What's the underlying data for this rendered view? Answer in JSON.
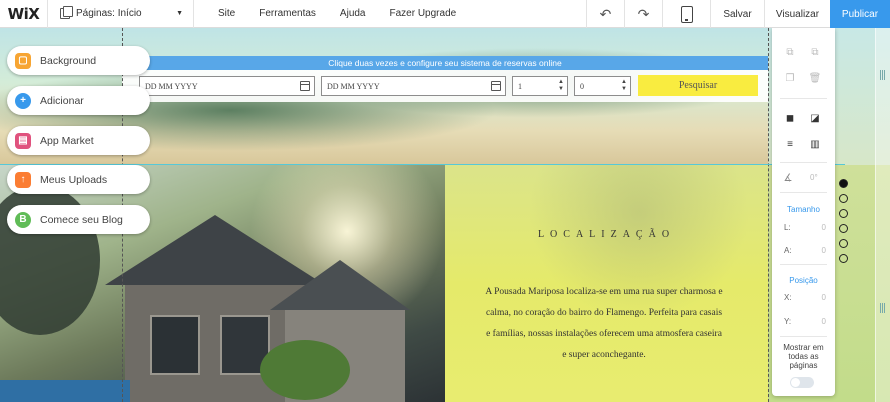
{
  "topbar": {
    "logo": "WiX",
    "pages_label": "Páginas: Início",
    "menu": [
      "Site",
      "Ferramentas",
      "Ajuda",
      "Fazer Upgrade"
    ],
    "undo_icon": "undo-icon",
    "redo_icon": "redo-icon",
    "device_icon": "mobile-device-icon",
    "save": "Salvar",
    "preview": "Visualizar",
    "publish": "Publicar",
    "publish_color": "#3899ec"
  },
  "left_panel": [
    {
      "label": "Background",
      "icon": "background-icon",
      "color": "#f7a533"
    },
    {
      "label": "Adicionar",
      "icon": "add-icon",
      "color": "#3899ec"
    },
    {
      "label": "App Market",
      "icon": "app-market-icon",
      "color": "#e0527e"
    },
    {
      "label": "Meus Uploads",
      "icon": "upload-icon",
      "color": "#fb7d33"
    },
    {
      "label": "Comece seu Blog",
      "icon": "blog-icon",
      "color": "#60bc57"
    }
  ],
  "booking": {
    "banner": "Clique duas vezes e configure seu sistema de reservas online",
    "checkin_placeholder": "DD MM YYYY",
    "checkout_placeholder": "DD MM YYYY",
    "adults": "1",
    "children": "0",
    "search": "Pesquisar"
  },
  "location": {
    "title": "LOCALIZAÇÃO",
    "text": "A Pousada Mariposa localiza-se em uma rua super charmosa e calma, no coração do bairro do Flamengo. Perfeita para casais e famílias, nossas instalações oferecem uma atmosfera caseira e super aconchegante."
  },
  "tool_panel": {
    "rotation": "0°",
    "size_label": "Tamanho",
    "width_key": "L:",
    "width_val": "0",
    "height_key": "A:",
    "height_val": "0",
    "position_label": "Posição",
    "x_key": "X:",
    "x_val": "0",
    "y_key": "Y:",
    "y_val": "0",
    "show_all_pages": "Mostrar em todas as páginas"
  }
}
